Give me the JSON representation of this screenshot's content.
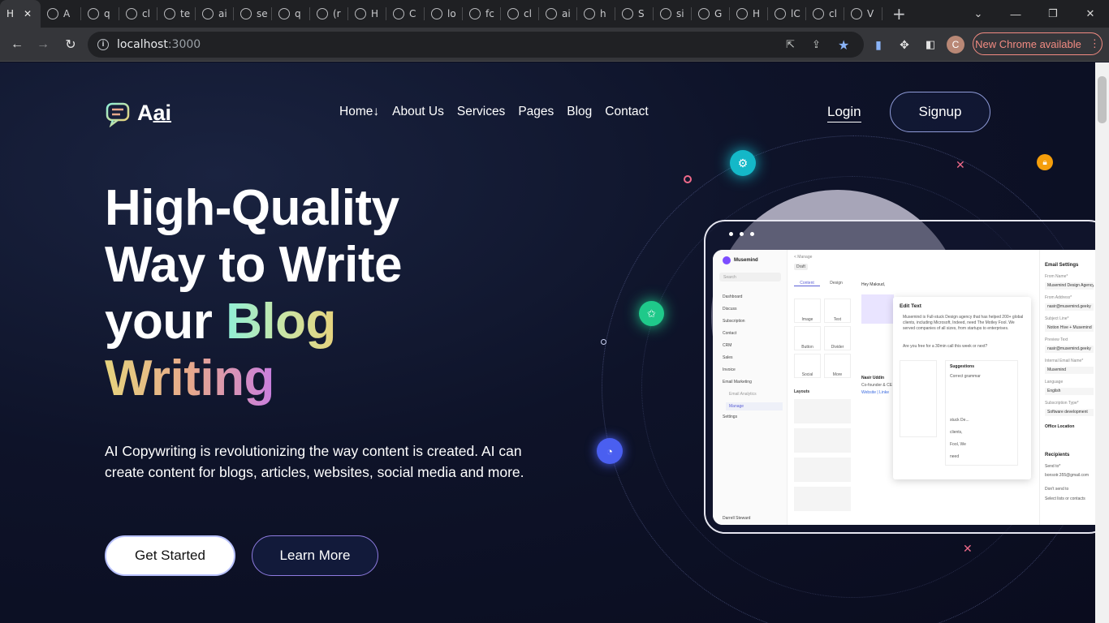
{
  "browser": {
    "tabs": [
      {
        "label": "H",
        "active": true
      },
      {
        "label": "A"
      },
      {
        "label": "q"
      },
      {
        "label": "cl"
      },
      {
        "label": "te"
      },
      {
        "label": "ai"
      },
      {
        "label": "se"
      },
      {
        "label": "q"
      },
      {
        "label": "(r"
      },
      {
        "label": "H"
      },
      {
        "label": "C"
      },
      {
        "label": "lo"
      },
      {
        "label": "fc"
      },
      {
        "label": "cl"
      },
      {
        "label": "ai"
      },
      {
        "label": "h"
      },
      {
        "label": "S"
      },
      {
        "label": "si"
      },
      {
        "label": "G"
      },
      {
        "label": "H"
      },
      {
        "label": "lC"
      },
      {
        "label": "cl"
      },
      {
        "label": "V"
      }
    ],
    "new_tab": "+",
    "url_host": "localhost",
    "url_port": ":3000",
    "update_label": "New Chrome available",
    "profile_initial": "C"
  },
  "site": {
    "logo_text": "A",
    "logo_suffix": "ai",
    "nav": [
      "Home",
      "About Us",
      "Services",
      "Pages",
      "Blog",
      "Contact"
    ],
    "home_arrow": "↓",
    "login": "Login",
    "signup": "Signup"
  },
  "hero": {
    "line1": "High-Quality",
    "line2": "Way to Write",
    "line3_plain": "your ",
    "line3_grad": "Blog",
    "line4": "Writing",
    "description": "AI Copywriting is revolutionizing the way content is created. AI can create content for blogs, articles, websites, social media and more.",
    "cta_primary": "Get Started",
    "cta_secondary": "Learn More"
  },
  "mockup": {
    "brand": "Musemind",
    "search": "Search",
    "sidebar": [
      "Dashboard",
      "Discuss",
      "Subscription",
      "Contact",
      "CRM",
      "Sales",
      "Invoice",
      "Email Marketing",
      "Email Analytics",
      "Manage",
      "Settings"
    ],
    "user": "Darrell Steward",
    "breadcrumb": "< Manage",
    "draft": "Draft",
    "tabs": [
      "Content",
      "Design"
    ],
    "blocks": [
      "Image",
      "Text",
      "Button",
      "Divider",
      "Social",
      "More"
    ],
    "layouts": "Layouts",
    "greeting": "Hey Maksud,",
    "edit_text_title": "Edit Text",
    "edit_text_body": "Musemind is Full-stuck Design agency that has helped 200+ global clients, including Microsoft, Indeed, need The Motley Fool. We served companies of all sizes, from startups to enterprises.",
    "edit_question": "Are you free for a 30min call this week or next?",
    "suggestions": "Suggestions",
    "suggestion_items": [
      "Correct grammar",
      "stuck De...",
      "clients,",
      "Fool, We",
      "need"
    ],
    "signature_name": "Nasir Uddin",
    "signature_role": "Co-founder & CE",
    "signature_links": "Website | Linke",
    "email_settings": "Email Settings",
    "fields": [
      {
        "label": "From Name*",
        "value": "Musemind Design Agency"
      },
      {
        "label": "From Address*",
        "value": "nasir@musemind.geeky"
      },
      {
        "label": "Subject Line*",
        "value": "Notion Hive + Musemind"
      },
      {
        "label": "Preview Text",
        "value": "nasir@musemind.geeky"
      },
      {
        "label": "Internal Email Name*",
        "value": "Musemind"
      },
      {
        "label": "Language",
        "value": "English"
      },
      {
        "label": "Subscription Type*",
        "value": "Software development"
      }
    ],
    "office_location": "Office Location",
    "recipients": "Recipients",
    "send_to": "Send to*",
    "send_to_value": "bonsotr.355@gmail.com",
    "dont_send": "Don't send to",
    "select_lists": "Select lists or contacts"
  },
  "colors": {
    "accent_teal": "#14b8c8",
    "accent_green": "#1fc98a",
    "accent_blue": "#4a5ff0",
    "accent_orange": "#f59e0b",
    "update_red": "#f28b82"
  }
}
